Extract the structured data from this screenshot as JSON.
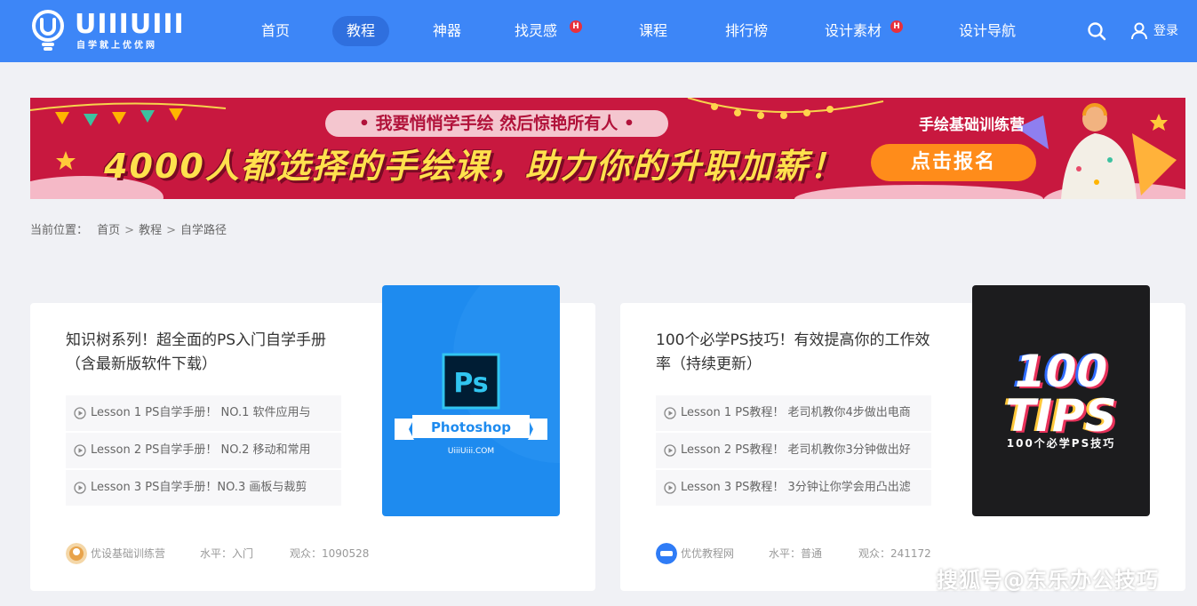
{
  "colors": {
    "header_bg": "#3d86f7",
    "active_tab_bg": "#2f6fde",
    "banner_bg": "#c8183f",
    "hot_badge": "#e8313d",
    "page_bg": "#f0f1f5",
    "ps_cover_bg": "#1e8bef",
    "tips_cover_bg": "#1c1c1e"
  },
  "header": {
    "logo": {
      "wordmark": "UIIIUIII",
      "tagline": "自学就上优优网",
      "icon": "lightbulb-icon"
    },
    "nav": [
      {
        "label": "首页",
        "active": false,
        "hot": false
      },
      {
        "label": "教程",
        "active": true,
        "hot": false
      },
      {
        "label": "神器",
        "active": false,
        "hot": false
      },
      {
        "label": "找灵感",
        "active": false,
        "hot": true
      },
      {
        "label": "课程",
        "active": false,
        "hot": false
      },
      {
        "label": "排行榜",
        "active": false,
        "hot": false
      },
      {
        "label": "设计素材",
        "active": false,
        "hot": true
      },
      {
        "label": "设计导航",
        "active": false,
        "hot": false
      }
    ],
    "hot_badge": "H",
    "search_icon": "search-icon",
    "login_icon": "user-icon",
    "login_label": "登录"
  },
  "banner": {
    "pill_text": "• 我要悄悄学手绘 然后惊艳所有人 •",
    "headline": "4000人都选择的手绘课，助力你的升职加薪！",
    "camp_label": "手绘基础训练营",
    "cta_label": "点击报名"
  },
  "breadcrumb": {
    "prefix": "当前位置：",
    "items": [
      "首页",
      "教程",
      "自学路径"
    ],
    "separator": ">"
  },
  "cards": [
    {
      "title": "知识树系列！超全面的PS入门自学手册（含最新版软件下载）",
      "lessons": [
        "Lesson 1 PS自学手册！ NO.1 软件应用与",
        "Lesson 2 PS自学手册！ NO.2 移动和常用",
        "Lesson 3 PS自学手册！NO.3 画板与裁剪"
      ],
      "cover": {
        "badge_text": "Ps",
        "ribbon_text": "Photoshop",
        "site_text": "UiiiUiii.COM"
      },
      "author": "优设基础训练营",
      "level": "水平：入门",
      "views": "观众：1090528"
    },
    {
      "title": "100个必学PS技巧！有效提高你的工作效率（持续更新）",
      "lessons": [
        "Lesson 1 PS教程！ 老司机教你4步做出电商",
        "Lesson 2 PS教程！ 老司机教你3分钟做出好",
        "Lesson 3 PS教程！ 3分钟让你学会用凸出滤"
      ],
      "cover": {
        "line1": "100",
        "line2": "TIPS",
        "subtitle": "100个必学PS技巧"
      },
      "author": "优优教程网",
      "level": "水平：普通",
      "views": "观众：241172"
    }
  ],
  "watermark": "搜狐号@东乐办公技巧"
}
